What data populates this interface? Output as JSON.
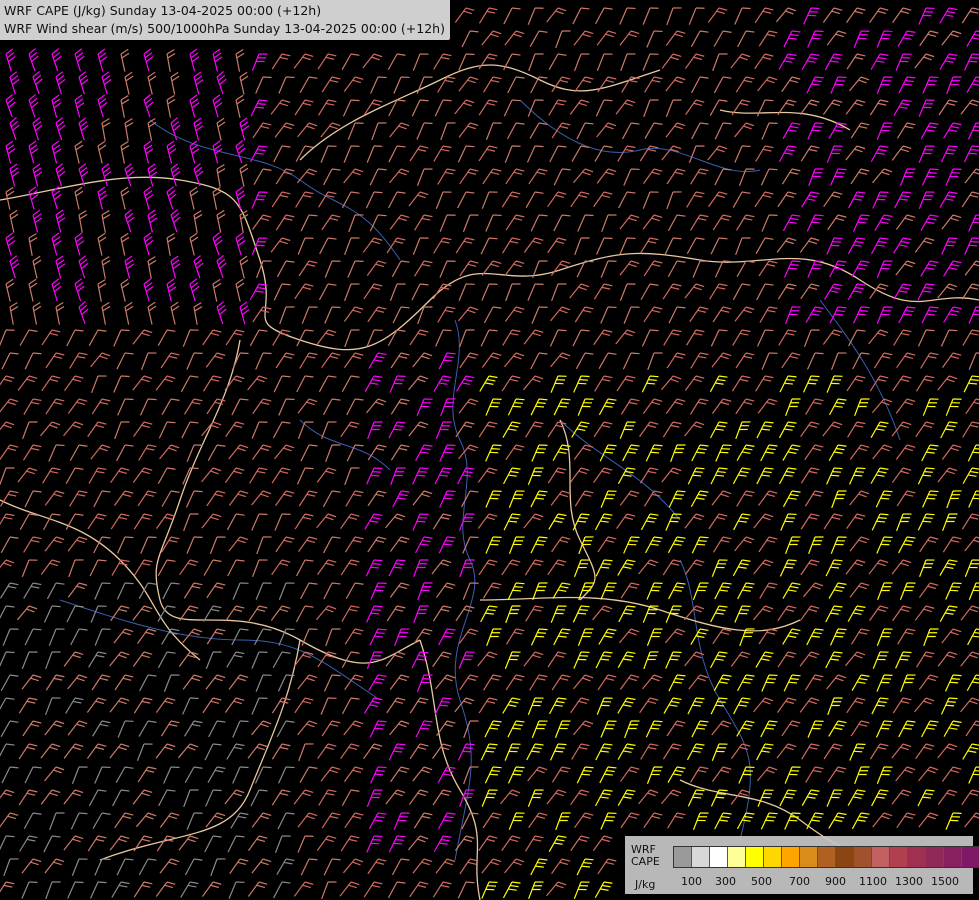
{
  "header": {
    "line1": "WRF CAPE (J/kg) Sunday 13-04-2025 00:00 (+12h)",
    "line2": "WRF Wind shear (m/s) 500/1000hPa Sunday 13-04-2025 00:00 (+12h)"
  },
  "legend": {
    "title_line1": "WRF",
    "title_line2": "CAPE",
    "unit": "J/kg",
    "ticks": [
      "100",
      "300",
      "500",
      "700",
      "900",
      "1100",
      "1300",
      "1500"
    ],
    "colors": [
      "#9a9a9a",
      "#d8d8d8",
      "#ffffff",
      "#ffff99",
      "#ffff00",
      "#ffd700",
      "#ffa500",
      "#d98c1a",
      "#b06020",
      "#8b4513",
      "#a0522d",
      "#c06060",
      "#b04050",
      "#a03050",
      "#902858",
      "#882060",
      "#801868",
      "#78106a"
    ]
  },
  "map": {
    "barb_colors": {
      "low": "#8a8a8a",
      "mid": "#cc7a6a",
      "moderate": "#d06a60",
      "high": "#ff00ff",
      "cape": "#ffff00"
    },
    "border_color": "#e8c8a0",
    "river_color": "#3a5fb0"
  }
}
